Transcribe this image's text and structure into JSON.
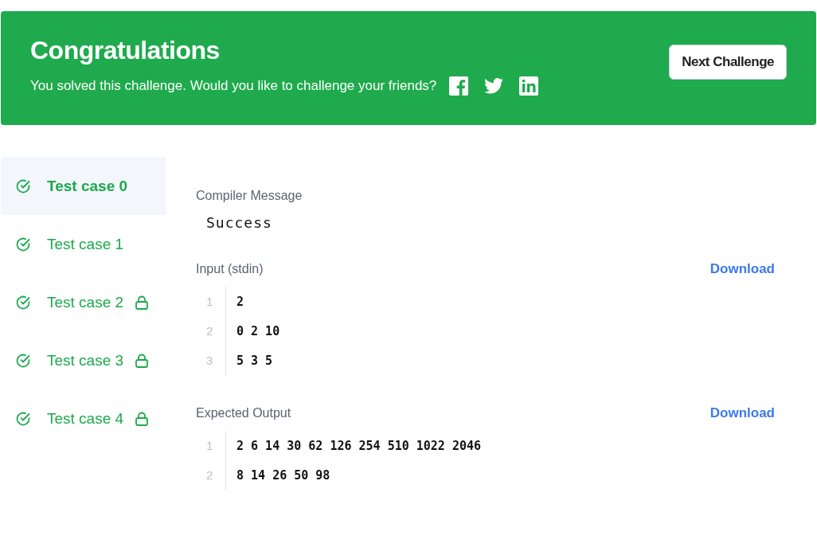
{
  "banner": {
    "title": "Congratulations",
    "message": "You solved this challenge. Would you like to challenge your friends?",
    "share": [
      {
        "kind": "facebook"
      },
      {
        "kind": "twitter"
      },
      {
        "kind": "linkedin"
      }
    ],
    "button": "Next Challenge"
  },
  "test_cases": [
    {
      "label": "Test case 0",
      "selected": true,
      "passed": true,
      "locked": false
    },
    {
      "label": "Test case 1",
      "selected": false,
      "passed": true,
      "locked": false
    },
    {
      "label": "Test case 2",
      "selected": false,
      "passed": true,
      "locked": true
    },
    {
      "label": "Test case 3",
      "selected": false,
      "passed": true,
      "locked": true
    },
    {
      "label": "Test case 4",
      "selected": false,
      "passed": true,
      "locked": true
    }
  ],
  "sections": [
    {
      "kind": "message",
      "title": "Compiler Message",
      "text": "Success"
    },
    {
      "kind": "code",
      "title": "Input (stdin)",
      "download": "Download",
      "lines": [
        {
          "number": "1",
          "text": "2"
        },
        {
          "number": "2",
          "text": "0 2 10"
        },
        {
          "number": "3",
          "text": "5 3 5"
        }
      ]
    },
    {
      "kind": "code",
      "title": "Expected Output",
      "download": "Download",
      "lines": [
        {
          "number": "1",
          "text": "2 6 14 30 62 126 254 510 1022 2046"
        },
        {
          "number": "2",
          "text": "8 14 26 50 98"
        }
      ]
    }
  ]
}
